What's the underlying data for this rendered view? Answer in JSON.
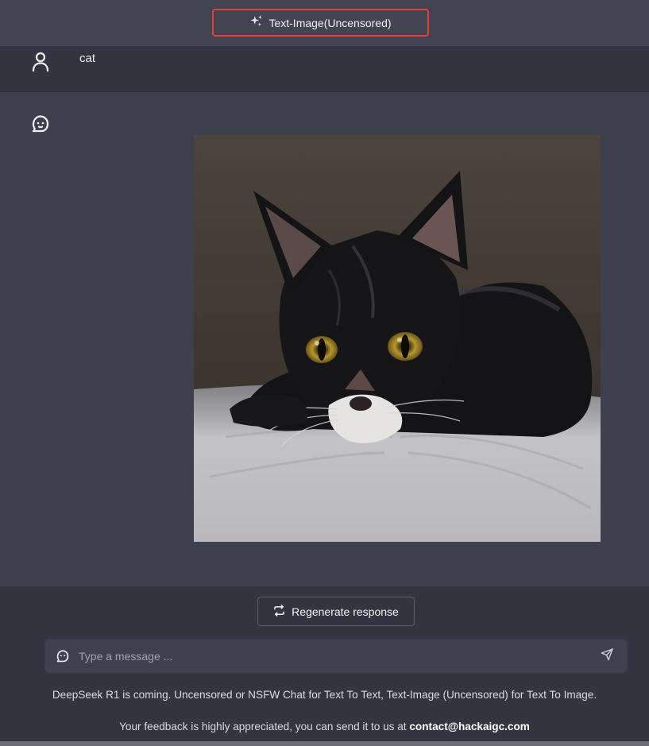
{
  "header": {
    "model_label": "Text-Image(Uncensored)",
    "model_icon": "sparkles-icon",
    "highlight_color": "#e0413a"
  },
  "conversation": {
    "user_message": "cat",
    "user_icon": "user-icon",
    "assistant_icon": "ghost-bot-icon",
    "assistant_image": {
      "subject": "generated-cat-image"
    }
  },
  "composer": {
    "regenerate_label": "Regenerate response",
    "regenerate_icon": "refresh-icon",
    "input_placeholder": "Type a message ...",
    "input_value": "",
    "send_icon": "send-icon"
  },
  "footer": {
    "notice": "DeepSeek R1 is coming. Uncensored or NSFW Chat for Text To Text, Text-Image (Uncensored) for Text To Image.",
    "feedback_prefix": "Your feedback is highly appreciated, you can send it to us at",
    "feedback_email": "contact@hackaigc.com"
  }
}
